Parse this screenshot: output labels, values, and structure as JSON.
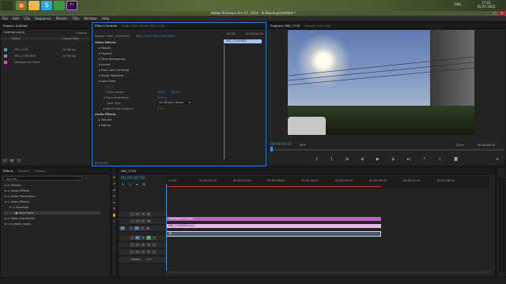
{
  "taskbar": {
    "time": "17:41",
    "date": "05.07.2015",
    "lang": "ENG"
  },
  "window": {
    "title": "Adobe Premiere Pro CC 2014 - D:\\Backup\\Untitled *",
    "min": "–",
    "max": "□",
    "close": "✕"
  },
  "menu": [
    "File",
    "Edit",
    "Clip",
    "Sequence",
    "Marker",
    "Title",
    "Window",
    "Help"
  ],
  "project": {
    "tab": "Project: Untitled",
    "file": "Untitled.prproj",
    "count": "3 Items",
    "col_name": "Name",
    "col_rate": "Frame Rate",
    "items": [
      {
        "name": "IMG_1744",
        "rate": "29,98 fps",
        "color": "#3aa6a6"
      },
      {
        "name": "IMG_1744.MOV",
        "rate": "29,98 fps",
        "color": "#8a7ad8"
      },
      {
        "name": "Transparent Video",
        "rate": "",
        "color": "#c65ac6"
      }
    ]
  },
  "effect_controls": {
    "tabs": [
      "Effect Controls",
      "Audio Track Mixer: IMG_1744"
    ],
    "master": "Master * IMG_1744.MOV",
    "seq": "IMG_1744 * IMG_1744.MOV",
    "time_start": "00:00",
    "time_end": "00:00:05:00",
    "clip_label": "IMG_1744.MOV",
    "section_video": "Video Effects",
    "section_audio": "Audio Effects",
    "effects": [
      "Motion",
      "Opacity",
      "Time Remapping",
      "Levels",
      "Fast Color Corrector",
      "Sharp Stabilizer",
      "Lens Flare"
    ],
    "lens": {
      "center_label": "Flare Center",
      "center_x": "780,8",
      "center_y": "824,0",
      "bright_label": "Flare Brightness",
      "bright": "100 %",
      "type_label": "Lens Type",
      "type": "50-300mm Zoom",
      "blend_label": "Blend With Original",
      "blend": "0 %"
    },
    "audio_effects": [
      "Volume",
      "Panner"
    ],
    "timecode": "00:00:00"
  },
  "program": {
    "tab": "Program: IMG_1744",
    "tab2": "Source: (no clips)",
    "timecode": "00:00:00:00",
    "fit": "Fit",
    "scale": "1/2",
    "duration": "00:00:00:13"
  },
  "effects_panel": {
    "tabs": [
      "Effects",
      "Markers",
      "History"
    ],
    "search": "lens fla",
    "tree": [
      {
        "label": "Presets",
        "depth": 0
      },
      {
        "label": "Audio Effects",
        "depth": 0
      },
      {
        "label": "Audio Transitions",
        "depth": 0
      },
      {
        "label": "Video Effects",
        "depth": 0
      },
      {
        "label": "Generate",
        "depth": 1
      },
      {
        "label": "Lens Flare",
        "depth": 2
      },
      {
        "label": "Video Transitions",
        "depth": 0
      },
      {
        "label": "Lumetri Looks",
        "depth": 0
      }
    ]
  },
  "timeline": {
    "tab": "IMG_1744",
    "timecode": "00:00:00:00",
    "ruler": [
      "00:00",
      "00:00:01:00",
      "00:00:02:00",
      "00:00:03:00",
      "00:00:04:00",
      "00:00:05:00",
      "00:00:06:00",
      "00:00:07:00",
      "00:00:08:00"
    ],
    "tracks_v": [
      "V3",
      "V2",
      "V1"
    ],
    "tracks_a": [
      "A1",
      "A2",
      "A3"
    ],
    "master": "Master",
    "master_val": "0.0",
    "clip_v3": "Transparent Video",
    "clip_v2": "IMG_1744.MOV [V]",
    "clip_a1": "fx"
  }
}
